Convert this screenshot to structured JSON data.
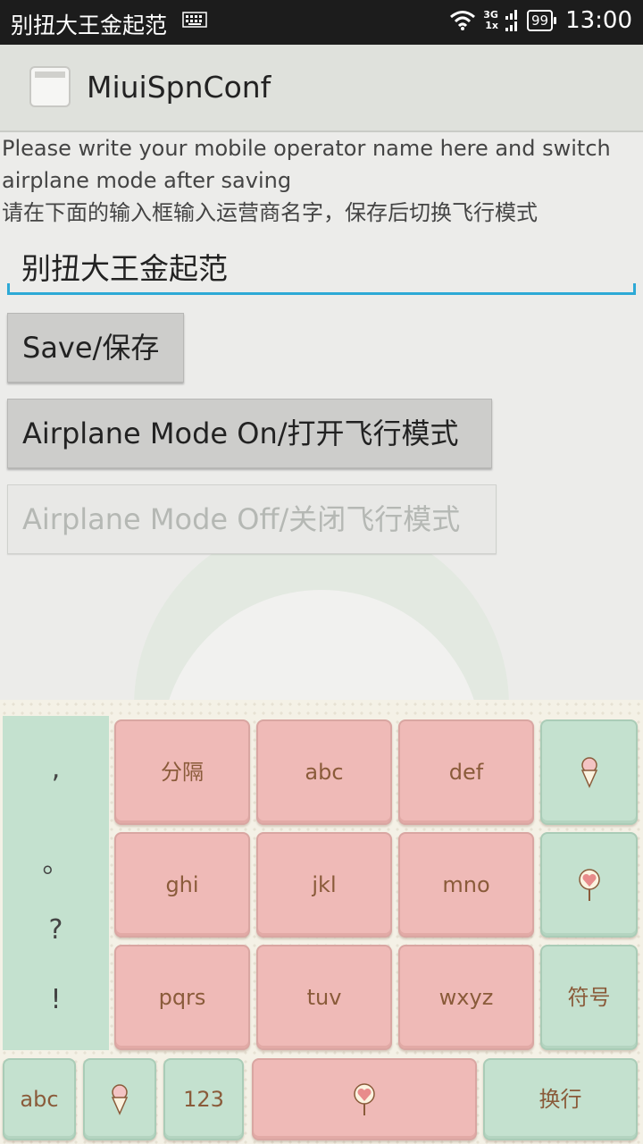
{
  "status_bar": {
    "carrier": "别扭大王金起范",
    "network_top": "3G",
    "network_bottom": "1x",
    "battery": "99",
    "time": "13:00"
  },
  "action_bar": {
    "title": "MiuiSpnConf"
  },
  "main": {
    "description_en": "Please write your mobile operator name here and switch airplane mode after saving",
    "description_zh": "请在下面的输入框输入运营商名字，保存后切换飞行模式",
    "operator_input_value": "别扭大王金起范",
    "save_button": "Save/保存",
    "airplane_on_button": "Airplane Mode On/打开飞行模式",
    "airplane_off_button": "Airplane Mode Off/关闭飞行模式"
  },
  "keyboard": {
    "punctuation": [
      ",",
      "。",
      "?",
      "!"
    ],
    "row1": [
      "分隔",
      "abc",
      "def"
    ],
    "row2": [
      "ghi",
      "jkl",
      "mno"
    ],
    "row3": [
      "pqrs",
      "tuv",
      "wxyz"
    ],
    "symbols_key": "符号",
    "bottom_abc": "abc",
    "bottom_123": "123",
    "enter_key": "换行",
    "colors": {
      "pink_key": "#efbab7",
      "mint_key": "#c4e1cf",
      "label": "#8a5b3a"
    }
  }
}
